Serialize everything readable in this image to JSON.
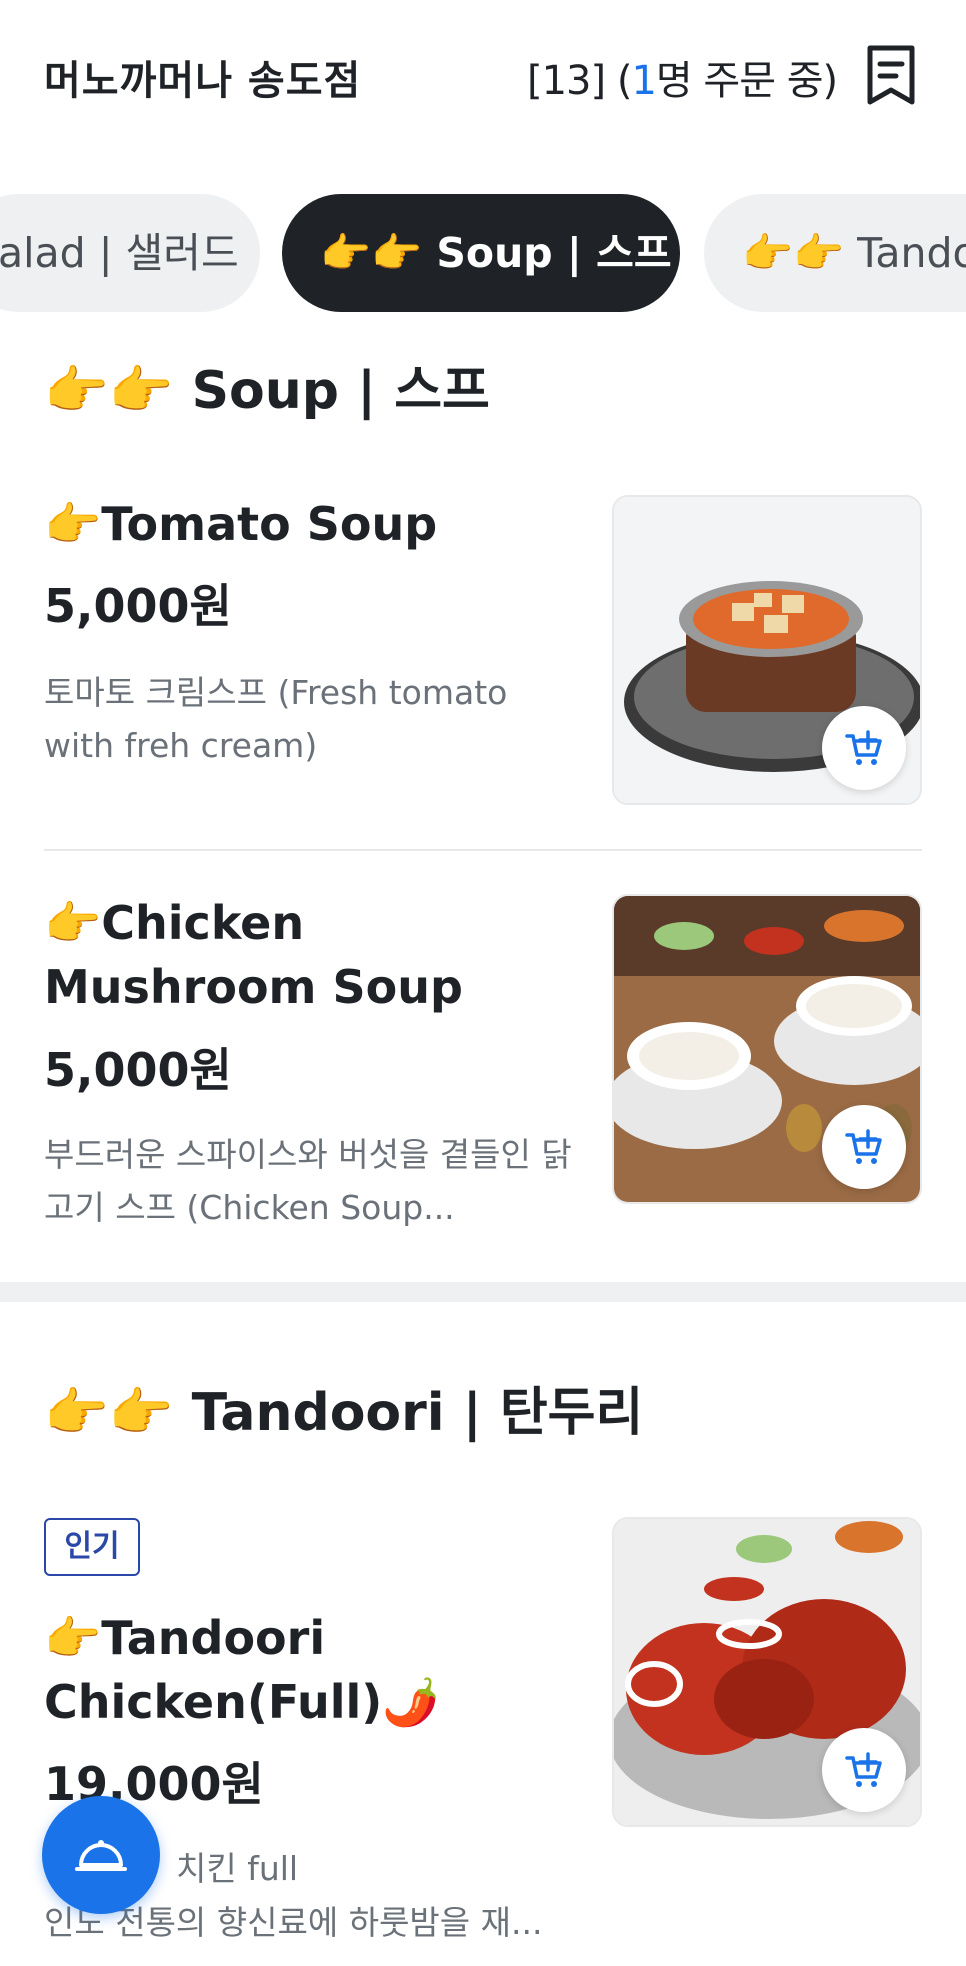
{
  "header": {
    "store_name": "머노까머나 송도점",
    "order_status_prefix": "[13] (",
    "order_count": "1",
    "order_status_suffix": "명 주문 중)"
  },
  "tabs": [
    {
      "label": "alad | 샐러드",
      "active": false
    },
    {
      "label": "👉👉 Soup | 스프",
      "active": true
    },
    {
      "label": "👉👉 Tandoo",
      "active": false
    }
  ],
  "soup_section": {
    "title": "👉👉 Soup | 스프",
    "items": [
      {
        "name": "👉Tomato Soup",
        "price": "5,000원",
        "desc": "토마토 크림스프 (Fresh tomato with freh cream)"
      },
      {
        "name": "👉Chicken Mushroom Soup",
        "price": "5,000원",
        "desc": "부드러운 스파이스와 버섯을 곁들인 닭고기 스프 (Chicken Soup..."
      }
    ]
  },
  "tandoori_section": {
    "title": "👉👉 Tandoori | 탄두리",
    "items": [
      {
        "badge": "인기",
        "name": "👉Tandoori Chicken(Full)🌶️",
        "price": "19,000원",
        "desc_line1": "치킨 full",
        "desc_line2": "인도 전통의 향신료에 하룻밤을 재..."
      }
    ]
  },
  "colors": {
    "accent": "#1a73e8",
    "dark": "#1f2328",
    "badge": "#2b47a8"
  }
}
